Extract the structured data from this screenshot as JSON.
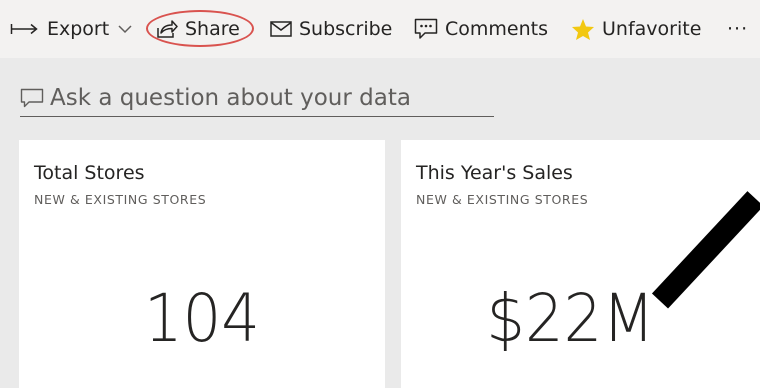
{
  "toolbar": {
    "export_label": "Export",
    "share_label": "Share",
    "subscribe_label": "Subscribe",
    "comments_label": "Comments",
    "unfavorite_label": "Unfavorite",
    "more_label": "···",
    "favorite_color": "#f2c811",
    "highlight_color": "#d9534f"
  },
  "qa": {
    "placeholder": "Ask a question about your data"
  },
  "tiles": [
    {
      "title": "Total Stores",
      "subtitle": "NEW & EXISTING STORES",
      "value": "104"
    },
    {
      "title": "This Year's Sales",
      "subtitle": "NEW & EXISTING STORES",
      "value": "$22M"
    }
  ]
}
